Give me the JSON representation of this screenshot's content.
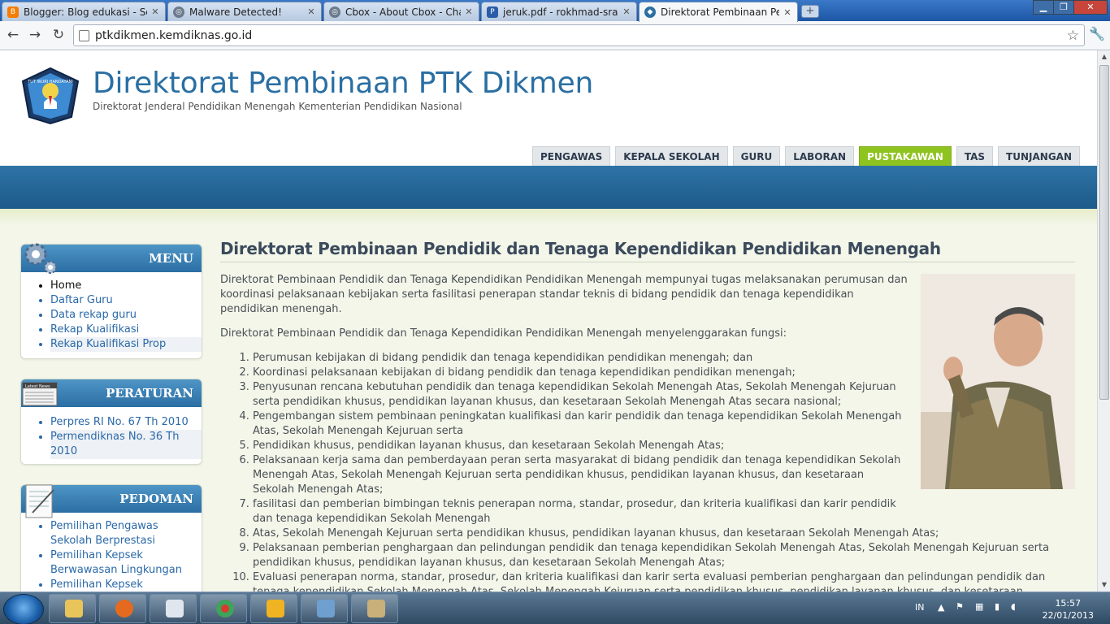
{
  "browser": {
    "tabs": [
      {
        "title": "Blogger: Blog edukasi - Sen",
        "icon": "blogger-icon",
        "color": "#f57d00"
      },
      {
        "title": "Malware Detected!",
        "icon": "globe-icon",
        "color": "#6b7b8c"
      },
      {
        "title": "Cbox - About Cbox - Chat ar",
        "icon": "globe-icon",
        "color": "#6b7b8c"
      },
      {
        "title": "jeruk.pdf - rokhmad-sragen",
        "icon": "pdf-icon",
        "color": "#2a5da8"
      },
      {
        "title": "Direktorat Pembinaan Pend",
        "icon": "site-favicon",
        "color": "#2a6fa3"
      }
    ],
    "url": "ptkdikmen.kemdiknas.go.id"
  },
  "site": {
    "title": "Direktorat Pembinaan PTK Dikmen",
    "subtitle": "Direktorat Jenderal Pendidikan Menengah Kementerian Pendidikan Nasional",
    "logo_text": "TUT WURI HANDAYANI",
    "nav": [
      "PENGAWAS",
      "KEPALA SEKOLAH",
      "GURU",
      "LABORAN",
      "PUSTAKAWAN",
      "TAS",
      "TUNJANGAN"
    ],
    "nav_selected": "PUSTAKAWAN",
    "accent": "#8fc31f",
    "band_color": "#2a6fa3"
  },
  "sidebar": {
    "menu": {
      "title": "MENU",
      "items": [
        "Home",
        "Daftar Guru",
        "Data rekap guru",
        "Rekap Kualifikasi",
        "Rekap Kualifikasi Prop"
      ]
    },
    "peraturan": {
      "title": "PERATURAN",
      "icon_label": "Latest News",
      "items": [
        "Perpres RI No. 67 Th 2010",
        "Permendiknas No. 36 Th 2010"
      ]
    },
    "pedoman": {
      "title": "PEDOMAN",
      "items": [
        "Pemilihan Pengawas Sekolah Berprestasi",
        "Pemilihan Kepsek Berwawasan Lingkungan",
        "Pemilihan Kepsek"
      ]
    }
  },
  "article": {
    "title": "Direktorat Pembinaan Pendidik dan Tenaga Kependidikan Pendidikan Menengah",
    "para1": "Direktorat Pembinaan Pendidik dan Tenaga Kependidikan Pendidikan Menengah mempunyai tugas melaksanakan perumusan dan koordinasi pelaksanaan kebijakan serta fasilitasi penerapan standar teknis di bidang pendidik dan tenaga kependidikan pendidikan menengah.",
    "para2": "Direktorat Pembinaan  Pendidik  dan Tenaga Kependidikan  Pendidikan  Menengah menyelenggarakan fungsi:",
    "functions": [
      "Perumusan kebijakan di bidang  pendidik  dan tenaga kependidikan   pendidikan menengah; dan",
      "Koordinasi  pelaksanaan  kebijakan  di bidang  pendidik  dan tenaga kependidikan pendidikan menengah;",
      "Penyusunan rencana kebutuhan pendidik dan tenaga kependidikan Sekolah Menengah Atas,  Sekolah Menengah Kejuruan serta pendidikan khusus, pendidikan layanan khusus, dan kesetaraan Sekolah Menengah Atas secara nasional;",
      "Pengembangan sistem pembinaan peningkatan kualifikasi dan karir  pendidik dan tenaga kependidikan  Sekolah Menengah Atas, Sekolah Menengah Kejuruan serta",
      "Pendidikan khusus, pendidikan layanan khusus, dan kesetaraan Sekolah Menengah Atas;",
      "Pelaksanaan kerja sama dan  pemberdayaan peran serta masyarakat di bidang pendidik dan tenaga kependidikan Sekolah Menengah Atas, Sekolah Menengah Kejuruan serta pendidikan khusus, pendidikan layanan khusus, dan kesetaraan Sekolah Menengah Atas;",
      "fasilitasi dan pemberian bimbingan teknis penerapan norma, standar, prosedur, dan kriteria kualifikasi dan karir pendidik dan tenaga kependidikan  Sekolah Menengah",
      "Atas, Sekolah Menengah Kejuruan serta pendidikan khusus, pendidikan layanan khusus, dan kesetaraan Sekolah Menengah Atas;",
      "Pelaksanaan pemberian penghargaan dan pelindungan pendidik dan tenaga kependidikan Sekolah Menengah Atas, Sekolah Menengah Kejuruan serta pendidikan khusus, pendidikan layanan khusus, dan kesetaraan Sekolah Menengah Atas;",
      "Evaluasi penerapan norma, standar, prosedur, dan kriteria kualifikasi dan karir serta evaluasi pemberian penghargaan dan pelindungan pendidik dan tenaga kependidikan Sekolah Menengah Atas, Sekolah Menengah Kejuruan serta pendidikan khusus, pendidikan layanan khusus, dan kesetaraan Sekolah Menengah"
    ]
  },
  "taskbar": {
    "apps": [
      "explorer-icon",
      "firefox-icon",
      "app-icon",
      "chrome-icon",
      "winamp-icon",
      "control-panel-icon",
      "paint-icon"
    ],
    "language": "IN",
    "time": "15:57",
    "date": "22/01/2013"
  }
}
